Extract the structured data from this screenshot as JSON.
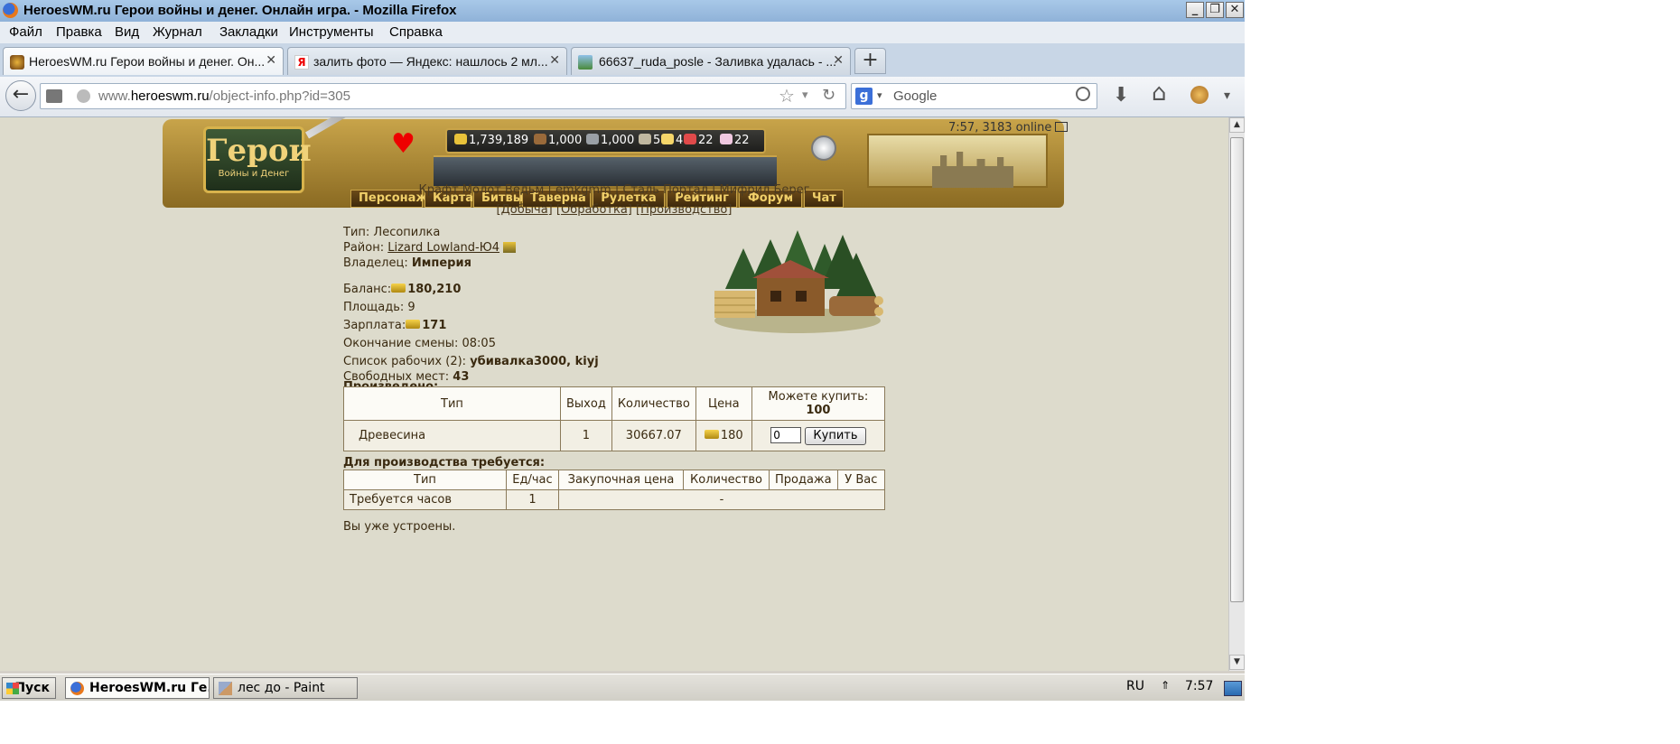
{
  "window": {
    "title": "HeroesWM.ru Герои войны и денег. Онлайн игра. - Mozilla Firefox",
    "minimize": "_",
    "maximize": "❐",
    "close": "✕"
  },
  "menu": [
    "Файл",
    "Правка",
    "Вид",
    "Журнал",
    "Закладки",
    "Инструменты",
    "Справка"
  ],
  "tabs": [
    {
      "label": "HeroesWM.ru Герои войны и денег. Он...",
      "close": "✕"
    },
    {
      "label": "залить фото — Яндекс: нашлось 2 мл...",
      "close": "✕"
    },
    {
      "label": "66637_ruda_posle - Заливка удалась - ...",
      "close": "✕"
    }
  ],
  "newtab": "+",
  "nav": {
    "back": "←",
    "url_prefix": "www.",
    "url_domain": "heroeswm.ru",
    "url_path": "/object-info.php?id=305",
    "search_placeholder": "Google",
    "search_engine": "g",
    "star": "☆",
    "reload": "↻",
    "download": "⬇",
    "home": "⌂",
    "menu_arrow": "▾"
  },
  "header": {
    "logo_main": "Герои",
    "logo_sub": "Войны и Денег",
    "resources": [
      {
        "value": "1,739,189",
        "color": "#e8c23a"
      },
      {
        "value": "1,000",
        "color": "#9a6a3a"
      },
      {
        "value": "1,000",
        "color": "#9aa0a6"
      },
      {
        "value": "5",
        "color": "#c0b8a0"
      },
      {
        "value": "4",
        "color": "#f5d66a"
      },
      {
        "value": "22",
        "color": "#e04a4a"
      },
      {
        "value": "22",
        "color": "#f0c8e0"
      }
    ],
    "time_online": "7:57, 3183 online",
    "nav_items": [
      "Персонаж",
      "Карта",
      "Битвы",
      "Таверна",
      "Рулетка",
      "Рейтинг",
      "Форум",
      "Чат"
    ]
  },
  "sublinks1": "Крафт Молот Ведьм | emkgmm | Сталь Портал | Мифрил Берег",
  "sublinks2": [
    "Добыча",
    "Обработка",
    "Производство"
  ],
  "object": {
    "type_label": "Тип:",
    "type_value": "Лесопилка",
    "district_label": "Район:",
    "district_value": "Lizard Lowland-Ю4",
    "owner_label": "Владелец:",
    "owner_value": "Империя",
    "balance_label": "Баланс:",
    "balance_value": "180,210",
    "area_label": "Площадь:",
    "area_value": "9",
    "salary_label": "Зарплата:",
    "salary_value": "171",
    "shift_label": "Окончание смены:",
    "shift_value": "08:05",
    "workers_label": "Список рабочих (2):",
    "workers_value": "убивалка3000, kiyj",
    "free_label": "Свободных мест:",
    "free_value": "43"
  },
  "produced": {
    "title": "Произведено:",
    "headers": [
      "Тип",
      "Выход",
      "Количество",
      "Цена",
      "Можете купить:"
    ],
    "can_buy": "100",
    "row": {
      "type": "Древесина",
      "output": "1",
      "quantity": "30667.07",
      "price": "180",
      "input_value": "0",
      "button": "Купить"
    }
  },
  "required": {
    "title": "Для производства требуется:",
    "headers": [
      "Тип",
      "Ед/час",
      "Закупочная цена",
      "Количество",
      "Продажа",
      "У Вас"
    ],
    "row": {
      "type": "Требуется часов",
      "per_hour": "1",
      "rest": "-"
    }
  },
  "status": "Вы уже устроены.",
  "taskbar": {
    "start": "Пуск",
    "items": [
      "HeroesWM.ru Ге...",
      "лес до - Paint"
    ],
    "lang": "RU",
    "arrows": "⇑",
    "clock": "7:57"
  }
}
